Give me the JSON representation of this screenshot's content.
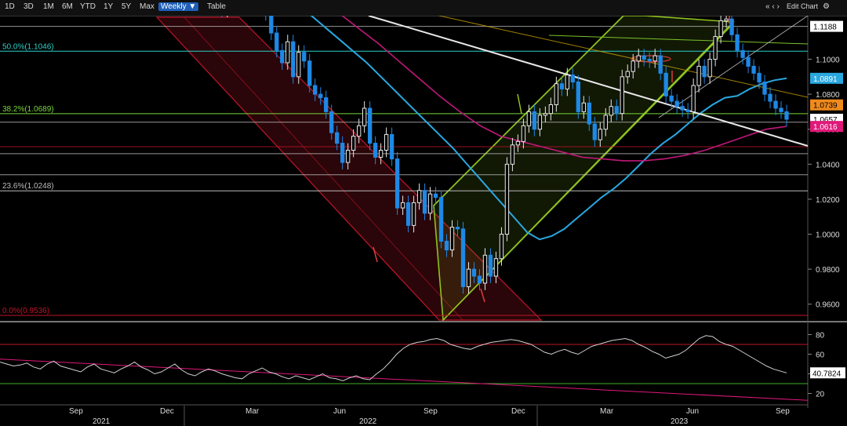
{
  "toolbar": {
    "ranges": [
      "1D",
      "3D",
      "1M",
      "6M",
      "YTD",
      "1Y",
      "5Y",
      "Max"
    ],
    "period": "Weekly",
    "period_arrow": "▼",
    "table": "Table",
    "nav_icons": "« ‹ ›",
    "edit": "Edit Chart",
    "gear_icon": "gear-icon"
  },
  "colors": {
    "up": "#e8e8e8",
    "down": "#1e88e5",
    "ma_fast": "#29a8e0",
    "ma_slow": "#c0187a",
    "channel_down": "#c0152a",
    "channel_up": "#8ec21f",
    "trend": "#e8e8e8",
    "fib_50": "#2bd0c8",
    "fib_382": "#7ad63a",
    "rsi": "#d0d0d0"
  },
  "chart_data": [
    {
      "type": "candlestick",
      "title": "",
      "x_ticks": [
        "Sep",
        "Dec",
        "Mar",
        "Jun",
        "Sep",
        "Dec",
        "Mar",
        "Jun",
        "Sep"
      ],
      "year_labels": [
        "2021",
        "2022",
        "2023"
      ],
      "ylim": [
        0.95,
        1.124
      ],
      "y_ticks": [
        "1.1000",
        "1.0800",
        "1.0600",
        "1.0400",
        "1.0200",
        "1.0000",
        "0.9800",
        "0.9600"
      ],
      "fib_levels": [
        {
          "label": "50.0%(1.1046)",
          "value": 1.1046
        },
        {
          "label": "38.2%(1.0689)",
          "value": 1.0689
        },
        {
          "label": "23.6%(1.0248)",
          "value": 1.0248
        },
        {
          "label": "0.0%(0.9536)",
          "value": 0.9536
        }
      ],
      "h_lines": [
        1.1188,
        1.064,
        1.05,
        1.046,
        1.034
      ],
      "price_tags": [
        {
          "text": "1.1188",
          "value": 1.1188,
          "bg": "#ffffff",
          "fg": "#000000"
        },
        {
          "text": "1.0891",
          "value": 1.0891,
          "bg": "#29a8e0",
          "fg": "#ffffff"
        },
        {
          "text": "1.0739",
          "value": 1.0739,
          "bg": "#f08a1c",
          "fg": "#000000"
        },
        {
          "text": "1.0657",
          "value": 1.0657,
          "bg": "#ffffff",
          "fg": "#000000"
        },
        {
          "text": "1.0616",
          "value": 1.0616,
          "bg": "#e0187a",
          "fg": "#ffffff"
        }
      ],
      "closes": [
        1.178,
        1.172,
        1.16,
        1.158,
        1.15,
        1.156,
        1.165,
        1.16,
        1.158,
        1.145,
        1.132,
        1.13,
        1.142,
        1.137,
        1.128,
        1.135,
        1.131,
        1.14,
        1.145,
        1.137,
        1.13,
        1.132,
        1.126,
        1.115,
        1.105,
        1.098,
        1.11,
        1.09,
        1.104,
        1.099,
        1.085,
        1.08,
        1.078,
        1.07,
        1.058,
        1.052,
        1.041,
        1.048,
        1.056,
        1.062,
        1.072,
        1.052,
        1.044,
        1.048,
        1.057,
        1.043,
        1.015,
        1.018,
        1.005,
        1.018,
        1.025,
        1.012,
        1.023,
        1.021,
        0.996,
        0.991,
        1.004,
        1.003,
        0.97,
        0.98,
        0.976,
        0.972,
        0.988,
        0.976,
        0.986,
        1.0,
        1.04,
        1.051,
        1.053,
        1.062,
        1.07,
        1.06,
        1.068,
        1.069,
        1.074,
        1.086,
        1.083,
        1.091,
        1.087,
        1.07,
        1.075,
        1.063,
        1.054,
        1.06,
        1.068,
        1.073,
        1.069,
        1.09,
        1.093,
        1.099,
        1.102,
        1.1,
        1.099,
        1.102,
        1.092,
        1.079,
        1.076,
        1.073,
        1.071,
        1.07,
        1.085,
        1.096,
        1.09,
        1.1,
        1.113,
        1.122,
        1.123,
        1.114,
        1.105,
        1.101,
        1.096,
        1.092,
        1.087,
        1.08,
        1.076,
        1.072,
        1.07,
        1.0657
      ],
      "ma_fast": [
        1.19,
        1.185,
        1.18,
        1.175,
        1.169,
        1.165,
        1.16,
        1.156,
        1.151,
        1.146,
        1.14,
        1.134,
        1.128,
        1.122,
        1.116,
        1.11,
        1.104,
        1.098,
        1.091,
        1.084,
        1.077,
        1.07,
        1.063,
        1.056,
        1.049,
        1.041,
        1.033,
        1.025,
        1.017,
        1.009,
        1.001,
        0.997,
        0.999,
        1.003,
        1.009,
        1.015,
        1.021,
        1.026,
        1.032,
        1.039,
        1.046,
        1.052,
        1.057,
        1.063,
        1.069,
        1.074,
        1.078,
        1.079,
        1.083,
        1.086,
        1.088,
        1.0891
      ],
      "ma_slow": [
        1.17,
        1.162,
        1.154,
        1.145,
        1.136,
        1.127,
        1.118,
        1.109,
        1.099,
        1.089,
        1.079,
        1.07,
        1.062,
        1.056,
        1.053,
        1.05,
        1.047,
        1.044,
        1.043,
        1.042,
        1.042,
        1.043,
        1.045,
        1.048,
        1.052,
        1.056,
        1.06,
        1.0616
      ]
    },
    {
      "type": "line",
      "title": "",
      "ylim": [
        10,
        90
      ],
      "y_ticks": [
        "80",
        "60",
        "40",
        "20"
      ],
      "last_value": "40.7824",
      "series": [
        {
          "name": "",
          "values": [
            52,
            50,
            48,
            49,
            51,
            47,
            45,
            50,
            53,
            48,
            46,
            44,
            42,
            47,
            50,
            45,
            43,
            41,
            45,
            48,
            52,
            47,
            44,
            40,
            42,
            46,
            50,
            44,
            40,
            38,
            42,
            45,
            43,
            40,
            38,
            36,
            35,
            40,
            43,
            46,
            42,
            40,
            37,
            35,
            38,
            36,
            34,
            37,
            40,
            36,
            35,
            33,
            36,
            38,
            35,
            34,
            40,
            45,
            52,
            60,
            66,
            70,
            72,
            73,
            75,
            76,
            74,
            70,
            68,
            66,
            65,
            68,
            70,
            72,
            73,
            74,
            75,
            74,
            72,
            70,
            66,
            62,
            60,
            63,
            65,
            62,
            60,
            64,
            68,
            70,
            72,
            74,
            75,
            76,
            74,
            70,
            67,
            63,
            60,
            56,
            58,
            60,
            64,
            70,
            76,
            79,
            78,
            73,
            70,
            68,
            64,
            60,
            56,
            52,
            48,
            45,
            43,
            41
          ]
        }
      ]
    }
  ]
}
